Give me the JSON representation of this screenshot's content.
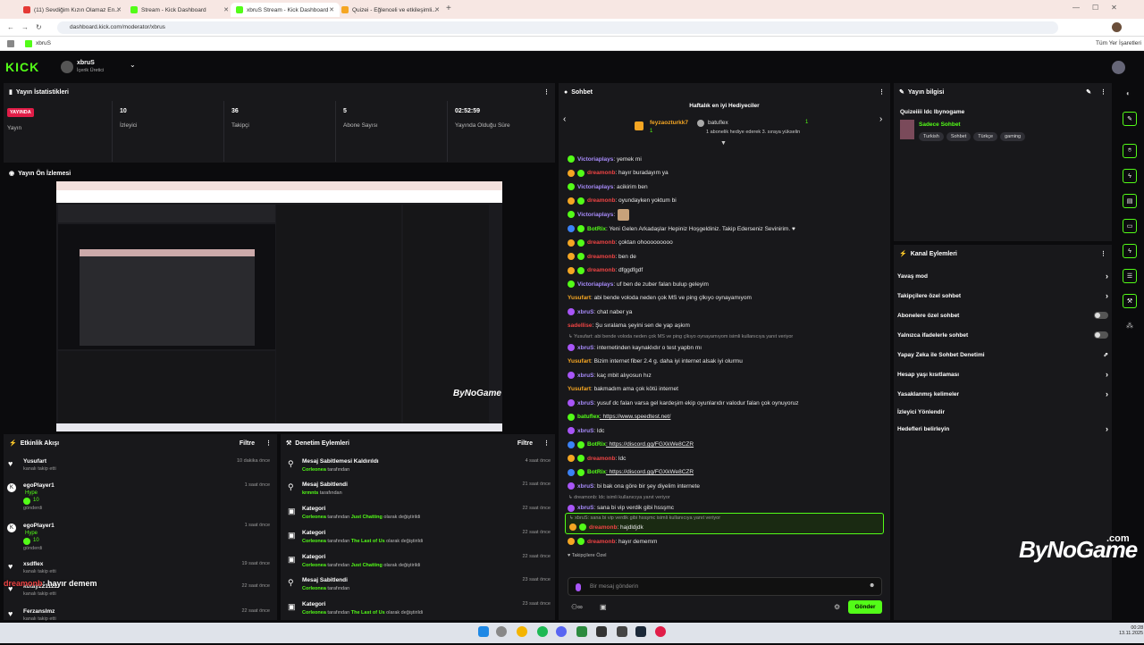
{
  "browser": {
    "tabs": [
      {
        "title": "(11) Sevdiğim Kızın Olamaz En...",
        "color": "#e53935"
      },
      {
        "title": "Stream - Kick Dashboard",
        "color": "#53fc18"
      },
      {
        "title": "xbruS Stream - Kick Dashboard",
        "color": "#53fc18"
      },
      {
        "title": "Quizei - Eğlenceli ve etkileşimli...",
        "color": "#f5a623"
      }
    ],
    "url": "dashboard.kick.com/moderator/xbrus",
    "bookmark": "xbruS",
    "all_bookmarks": "Tüm Yer İşaretleri"
  },
  "kick": {
    "logo": "KICK",
    "user": "xbruS",
    "role": "İçerik Üretici"
  },
  "stats": {
    "title": "Yayın İstatistikleri",
    "live_badge": "YAYINDA",
    "live_label": "Yayın",
    "viewers_value": "10",
    "viewers_label": "İzleyici",
    "followers_value": "36",
    "followers_label": "Takipçi",
    "subs_value": "5",
    "subs_label": "Abone Sayısı",
    "uptime_value": "02:52:59",
    "uptime_label": "Yayında Olduğu Süre"
  },
  "preview": {
    "title": "Yayın Ön İzlemesi",
    "watermark": "ByNoGame"
  },
  "activity": {
    "title": "Etkinlik Akışı",
    "filter": "Filtre",
    "items": [
      {
        "name": "Yusufart",
        "desc": "kanalı takip etti",
        "time": "10 dakika önce"
      },
      {
        "name": "egoPlayer1",
        "desc": "Hype",
        "amount": "10",
        "sub": "gönderdi",
        "time": "1 saat önce"
      },
      {
        "name": "egoPlayer1",
        "desc": "Hype",
        "amount": "10",
        "sub": "gönderdi",
        "time": "1 saat önce"
      },
      {
        "name": "xsdflex",
        "desc": "kanalı takip etti",
        "time": "19 saat önce"
      },
      {
        "name": "kutay221122",
        "desc": "kanalı takip etti",
        "time": "22 saat önce"
      },
      {
        "name": "Ferzanslmz",
        "desc": "kanalı takip etti",
        "time": "22 saat önce"
      }
    ],
    "overlay_user": "dreamonb",
    "overlay_msg": ": hayır demem"
  },
  "moderation": {
    "title": "Denetim Eylemleri",
    "filter": "Filtre",
    "items": [
      {
        "title": "Mesaj Sabitlemesi Kaldırıldı",
        "who": "Corleonea",
        "rest": " tarafından",
        "time": "4 saat önce"
      },
      {
        "title": "Mesaj Sabitlendi",
        "who": "krmnts",
        "rest": " tarafından",
        "time": "21 saat önce"
      },
      {
        "title": "Kategori",
        "who": "Corleonea",
        "rest": " tarafından ",
        "cat": "Just Chatting",
        "rest2": " olarak değiştirildi",
        "time": "22 saat önce"
      },
      {
        "title": "Kategori",
        "who": "Corleonea",
        "rest": " tarafından ",
        "cat": "The Last of Us",
        "rest2": " olarak değiştirildi",
        "time": "22 saat önce"
      },
      {
        "title": "Kategori",
        "who": "Corleonea",
        "rest": " tarafından ",
        "cat": "Just Chatting",
        "rest2": " olarak değiştirildi",
        "time": "22 saat önce"
      },
      {
        "title": "Mesaj Sabitlendi",
        "who": "Corleonea",
        "rest": " tarafından",
        "time": "23 saat önce"
      },
      {
        "title": "Kategori",
        "who": "Corleonea",
        "rest": " tarafından ",
        "cat": "The Last of Us",
        "rest2": " olarak değiştirildi",
        "time": "23 saat önce"
      }
    ]
  },
  "chat": {
    "title": "Sohbet",
    "gifters_title": "Haftalık en iyi Hediyeciler",
    "gifter1": "feyzaozturkk7",
    "gifter1_count": "1",
    "gifter2": "batuflex",
    "gifter2_count": "1",
    "gift_hint": "1 abonelik hediye ederek 3. sıraya yükselin",
    "messages": [
      {
        "user": "Victoriaplays",
        "color": "#a78bfa",
        "text": ": yemek mi",
        "badges": [
          "g"
        ]
      },
      {
        "user": "dreamonb",
        "color": "#ef4444",
        "text": ": hayır buradayım ya",
        "badges": [
          "o",
          "g"
        ]
      },
      {
        "user": "Victoriaplays",
        "color": "#a78bfa",
        "text": ": acikirim ben",
        "badges": [
          "g"
        ]
      },
      {
        "user": "dreamonb",
        "color": "#ef4444",
        "text": ": oyundayken yoktum bi",
        "badges": [
          "o",
          "g"
        ]
      },
      {
        "user": "Victoriaplays",
        "color": "#a78bfa",
        "text": ":",
        "badges": [
          "g"
        ]
      },
      {
        "user": "BotRix",
        "color": "#53fc18",
        "text": ": Yeni Gelen Arkadaşlar Hepiniz Hoşgeldiniz. Takip Ederseniz Sevinirim. ♥",
        "badges": [
          "b",
          "g"
        ]
      },
      {
        "user": "dreamonb",
        "color": "#ef4444",
        "text": ": çoktan ohooooooooo",
        "badges": [
          "o",
          "g"
        ]
      },
      {
        "user": "dreamonb",
        "color": "#ef4444",
        "text": ": ben de",
        "badges": [
          "o",
          "g"
        ]
      },
      {
        "user": "dreamonb",
        "color": "#ef4444",
        "text": ": dfggdfgdf",
        "badges": [
          "o",
          "g"
        ]
      },
      {
        "user": "Victoriaplays",
        "color": "#a78bfa",
        "text": ": uf ben de zuber falan bulup geleyim",
        "badges": [
          "g"
        ]
      },
      {
        "user": "Yusufart",
        "color": "#f5a623",
        "text": ": abi bende voloda neden çok MS ve ping çlkıyo oynayamıyom",
        "badges": []
      },
      {
        "user": "xbruS",
        "color": "#a78bfa",
        "text": ": chat naber ya",
        "badges": [
          "p"
        ]
      },
      {
        "user": "sadellise",
        "color": "#ef4444",
        "text": ": Şu sıralama şeyini sen de yap aşkım",
        "badges": []
      },
      {
        "reply": "↳ Yusufart: abi bende voloda neden çok MS ve ping çlkıyo oynayamıyom isimli kullanıcıya yanıt veriyor"
      },
      {
        "user": "xbruS",
        "color": "#a78bfa",
        "text": ": internetinden kaynaklıdır o test yapbn mı",
        "badges": [
          "p"
        ]
      },
      {
        "user": "Yusufart",
        "color": "#f5a623",
        "text": ": Bizim internet fiber 2.4 g. daha iyi internet alsak iyi olurmu",
        "badges": []
      },
      {
        "user": "xbruS",
        "color": "#a78bfa",
        "text": ": kaç mbit alıyosun hız",
        "badges": [
          "p"
        ]
      },
      {
        "user": "Yusufart",
        "color": "#f5a623",
        "text": ": bakmadım ama çok kötü internet",
        "badges": []
      },
      {
        "user": "xbruS",
        "color": "#a78bfa",
        "text": ": yusuf dc falan varsa gel kardeşim ekip oyunlarıdır valodur falan çok oynuyoruz",
        "badges": [
          "p"
        ]
      },
      {
        "user": "batuflex",
        "color": "#53fc18",
        "text": ": https://www.speedtest.net/",
        "badges": [
          "g"
        ]
      },
      {
        "user": "xbruS",
        "color": "#a78bfa",
        "text": ": ldc",
        "badges": [
          "p"
        ]
      },
      {
        "user": "BotRix",
        "color": "#53fc18",
        "text": ": https://discord.gg/FGXkWe8CZR",
        "badges": [
          "b",
          "g"
        ]
      },
      {
        "user": "dreamonb",
        "color": "#ef4444",
        "text": ": ldc",
        "badges": [
          "o",
          "g"
        ]
      },
      {
        "user": "BotRix",
        "color": "#53fc18",
        "text": ": https://discord.gg/FGXkWe8CZR",
        "badges": [
          "b",
          "g"
        ]
      },
      {
        "user": "xbruS",
        "color": "#a78bfa",
        "text": ": bi bak ona göre bir şey diyelim internete",
        "badges": [
          "p"
        ]
      },
      {
        "reply": "↳ dreamonb: ldc isimli kullanıcıya yanıt veriyor"
      },
      {
        "user": "xbruS",
        "color": "#a78bfa",
        "text": ": sana bi vip verdik gibi hssşmc",
        "badges": [
          "p"
        ]
      }
    ],
    "highlight_reply": "↳ xbruS: sana bi vip verdik gibi hssşmc isimli kullanıcıya yanıt veriyor",
    "highlight_user": "dreamonb",
    "highlight_text": ": hajdldjdk",
    "last_user": "dreamonb",
    "last_text": ": hayır dememm",
    "emote_label": "♥ Takipçilere Özel",
    "input_placeholder": "Bir mesaj gönderin",
    "send": "Gönder"
  },
  "info": {
    "title": "Yayın bilgisi",
    "stream_title": "Quizeiiii ldc Ibynogame",
    "category": "Sadece Sohbet",
    "tags": [
      "Turkish",
      "Sohbet",
      "Türkçe",
      "gaming"
    ]
  },
  "actions": {
    "title": "Kanal Eylemleri",
    "items": [
      {
        "label": "Yavaş mod",
        "kind": "arrow"
      },
      {
        "label": "Takipçilere özel sohbet",
        "kind": "arrow"
      },
      {
        "label": "Abonelere özel sohbet",
        "kind": "toggle"
      },
      {
        "label": "Yalnızca ifadelerle sohbet",
        "kind": "toggle"
      },
      {
        "label": "Yapay Zeka ile Sohbet Denetimi",
        "kind": "link"
      },
      {
        "label": "Hesap yaşı kısıtlaması",
        "kind": "arrow"
      },
      {
        "label": "Yasaklanmış kelimeler",
        "kind": "arrow"
      },
      {
        "label": "İzleyici Yönlendir",
        "kind": "none"
      },
      {
        "label": "Hedefleri belirleyin",
        "kind": "arrow"
      }
    ]
  },
  "watermark": {
    "text": "ByNoGame",
    "suffix": ".com"
  },
  "taskbar": {
    "time": "00:28",
    "date": "13.11.2025"
  }
}
